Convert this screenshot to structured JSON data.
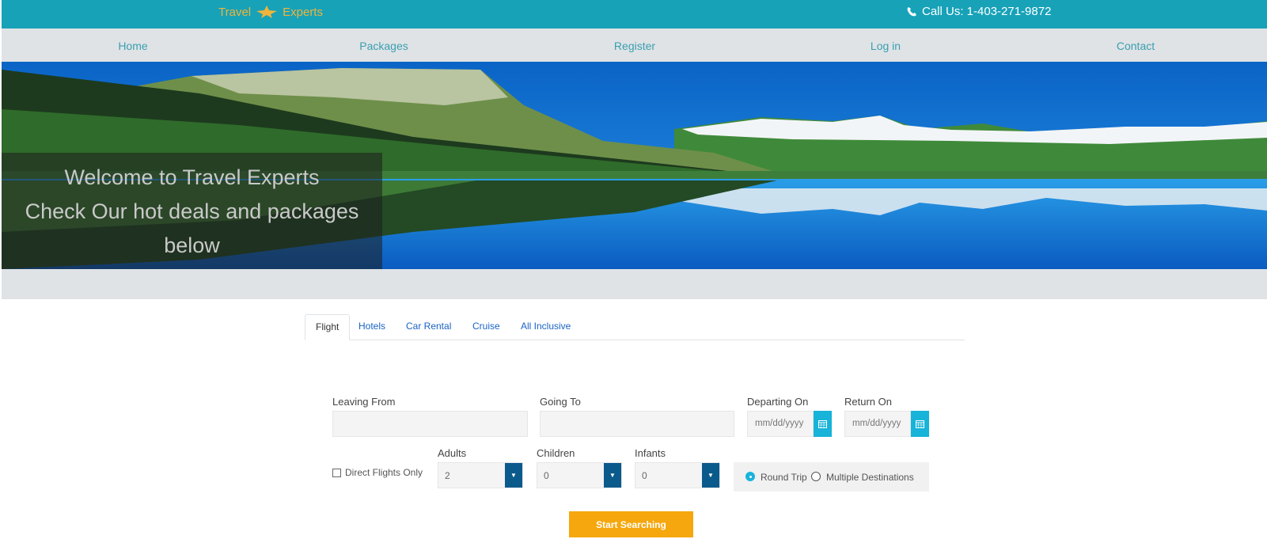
{
  "header": {
    "brand_left": "Travel",
    "brand_right": "Experts",
    "brand_icon": "plane-star-icon",
    "phone_icon": "phone-icon",
    "phone_text": "Call Us: 1-403-271-9872"
  },
  "nav": {
    "items": [
      {
        "label": "Home"
      },
      {
        "label": "Packages"
      },
      {
        "label": "Register"
      },
      {
        "label": "Log in"
      },
      {
        "label": "Contact"
      }
    ]
  },
  "hero": {
    "line1": "Welcome to Travel Experts",
    "line2": "Check Our hot deals and packages",
    "line3": "below"
  },
  "tabs": [
    {
      "label": "Flight",
      "active": true
    },
    {
      "label": "Hotels"
    },
    {
      "label": "Car Rental"
    },
    {
      "label": "Cruise"
    },
    {
      "label": "All Inclusive"
    }
  ],
  "form": {
    "leaving_label": "Leaving From",
    "leaving_value": "",
    "going_label": "Going To",
    "going_value": "",
    "departing_label": "Departing On",
    "departing_placeholder": "mm/dd/yyyy",
    "return_label": "Return On",
    "return_placeholder": "mm/dd/yyyy",
    "direct_label": "Direct Flights Only",
    "adults_label": "Adults",
    "adults_value": "2",
    "children_label": "Children",
    "children_value": "0",
    "infants_label": "Infants",
    "infants_value": "0",
    "round_trip_label": "Round Trip",
    "multi_dest_label": "Multiple Destinations",
    "search_label": "Start Searching"
  },
  "colors": {
    "topbar": "#17a2b8",
    "brand": "#f0b43a",
    "nav_bg": "#dfe3e6",
    "nav_link": "#3a9fb0",
    "accent": "#17b3d8",
    "select_arrow": "#0b5a8c",
    "search_button": "#f5a70d"
  }
}
